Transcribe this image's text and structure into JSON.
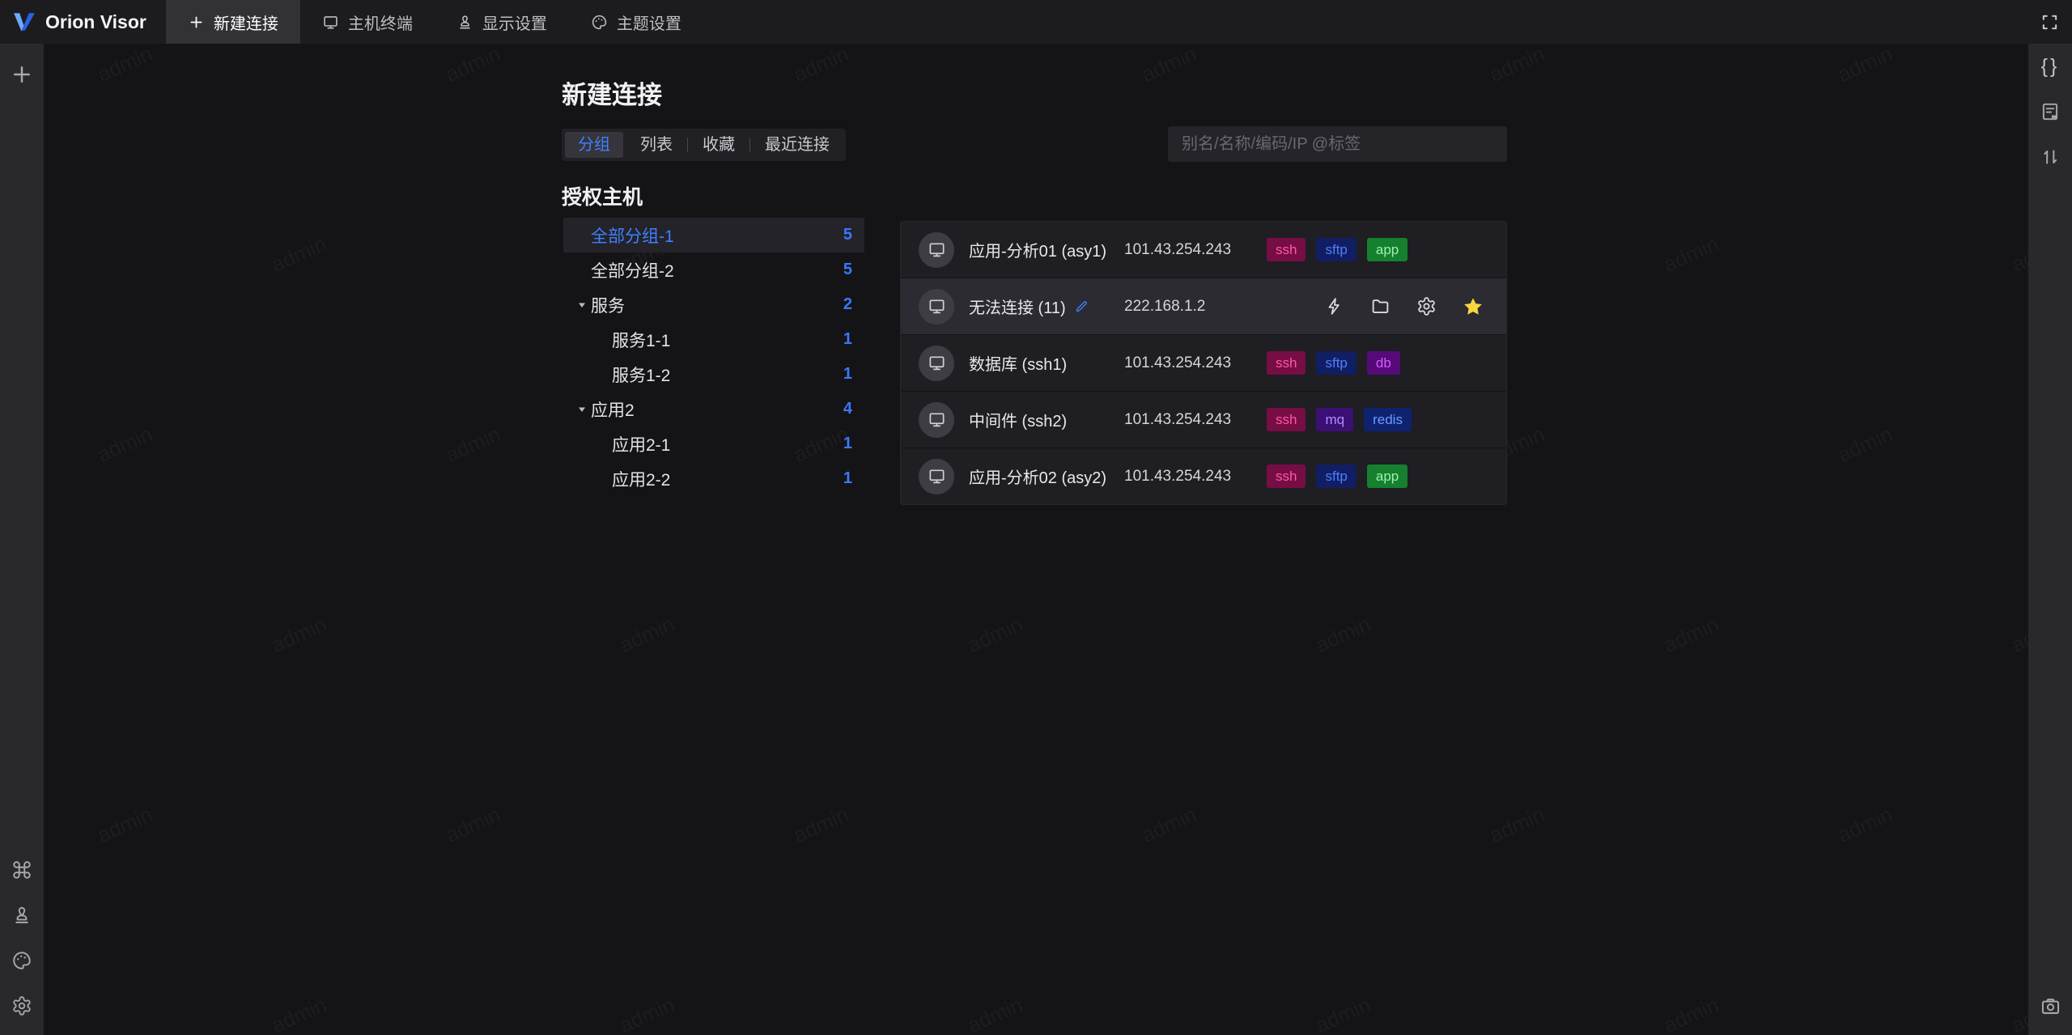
{
  "app": {
    "brand": "Orion Visor",
    "watermark": "admin"
  },
  "topbar": {
    "tabs": [
      {
        "label": "新建连接",
        "icon": "plus-icon",
        "active": true
      },
      {
        "label": "主机终端",
        "icon": "terminal-monitor-icon",
        "active": false
      },
      {
        "label": "显示设置",
        "icon": "stamp-icon",
        "active": false
      },
      {
        "label": "主题设置",
        "icon": "palette-icon",
        "active": false
      }
    ]
  },
  "page": {
    "title": "新建连接",
    "section_title": "授权主机"
  },
  "view_tabs": {
    "options": [
      "分组",
      "列表",
      "收藏",
      "最近连接"
    ],
    "active": "分组"
  },
  "search": {
    "placeholder": "别名/名称/编码/IP @标签",
    "value": ""
  },
  "tree": {
    "items": [
      {
        "label": "全部分组-1",
        "count": "5",
        "level": 0,
        "caret": false,
        "selected": true
      },
      {
        "label": "全部分组-2",
        "count": "5",
        "level": 0,
        "caret": false,
        "selected": false
      },
      {
        "label": "服务",
        "count": "2",
        "level": 0,
        "caret": true,
        "selected": false
      },
      {
        "label": "服务1-1",
        "count": "1",
        "level": 1,
        "caret": false,
        "selected": false
      },
      {
        "label": "服务1-2",
        "count": "1",
        "level": 1,
        "caret": false,
        "selected": false
      },
      {
        "label": "应用2",
        "count": "4",
        "level": 0,
        "caret": true,
        "selected": false
      },
      {
        "label": "应用2-1",
        "count": "1",
        "level": 1,
        "caret": false,
        "selected": false
      },
      {
        "label": "应用2-2",
        "count": "1",
        "level": 1,
        "caret": false,
        "selected": false
      }
    ]
  },
  "hosts": {
    "rows": [
      {
        "name": "应用-分析01 (asy1)",
        "ip": "101.43.254.243",
        "tags": [
          {
            "label": "ssh",
            "color": "magenta"
          },
          {
            "label": "sftp",
            "color": "blue"
          },
          {
            "label": "app",
            "color": "green"
          }
        ],
        "hover": false,
        "editable": false
      },
      {
        "name": "无法连接 (11)",
        "ip": "222.168.1.2",
        "tags": [],
        "hover": true,
        "editable": true,
        "favorite": true
      },
      {
        "name": "数据库 (ssh1)",
        "ip": "101.43.254.243",
        "tags": [
          {
            "label": "ssh",
            "color": "magenta"
          },
          {
            "label": "sftp",
            "color": "blue"
          },
          {
            "label": "db",
            "color": "purple"
          }
        ],
        "hover": false,
        "editable": false
      },
      {
        "name": "中间件 (ssh2)",
        "ip": "101.43.254.243",
        "tags": [
          {
            "label": "ssh",
            "color": "magenta"
          },
          {
            "label": "mq",
            "color": "violet"
          },
          {
            "label": "redis",
            "color": "navy"
          }
        ],
        "hover": false,
        "editable": false
      },
      {
        "name": "应用-分析02 (asy2)",
        "ip": "101.43.254.243",
        "tags": [
          {
            "label": "ssh",
            "color": "magenta"
          },
          {
            "label": "sftp",
            "color": "blue"
          },
          {
            "label": "app",
            "color": "green"
          }
        ],
        "hover": false,
        "editable": false
      }
    ]
  },
  "tag_colors": {
    "magenta": {
      "bg": "#770d45",
      "fg": "#ff57a9"
    },
    "blue": {
      "bg": "#111e63",
      "fg": "#4d7eff"
    },
    "green": {
      "bg": "#15802e",
      "fg": "#9df0ae"
    },
    "purple": {
      "bg": "#560a78",
      "fg": "#d45aff"
    },
    "violet": {
      "bg": "#3b1075",
      "fg": "#b28aff"
    },
    "navy": {
      "bg": "#0e2270",
      "fg": "#6b9bff"
    }
  },
  "colors": {
    "accent_blue": "#4080ff",
    "count_blue": "#3a78ff",
    "star_yellow": "#f7d63e",
    "topbar_bg": "#1c1c1f",
    "rail_bg": "#29292c",
    "main_bg": "#141417"
  },
  "icons": {
    "left_rail": [
      "plus-icon",
      "command-icon",
      "stamp-icon",
      "palette-icon",
      "gear-icon"
    ],
    "right_rail": [
      "braces-icon",
      "doc-bookmark-icon",
      "sort-arrows-icon",
      "camera-icon"
    ],
    "host_actions": [
      "bolt-icon",
      "folder-icon",
      "gear-icon",
      "star-icon"
    ]
  }
}
